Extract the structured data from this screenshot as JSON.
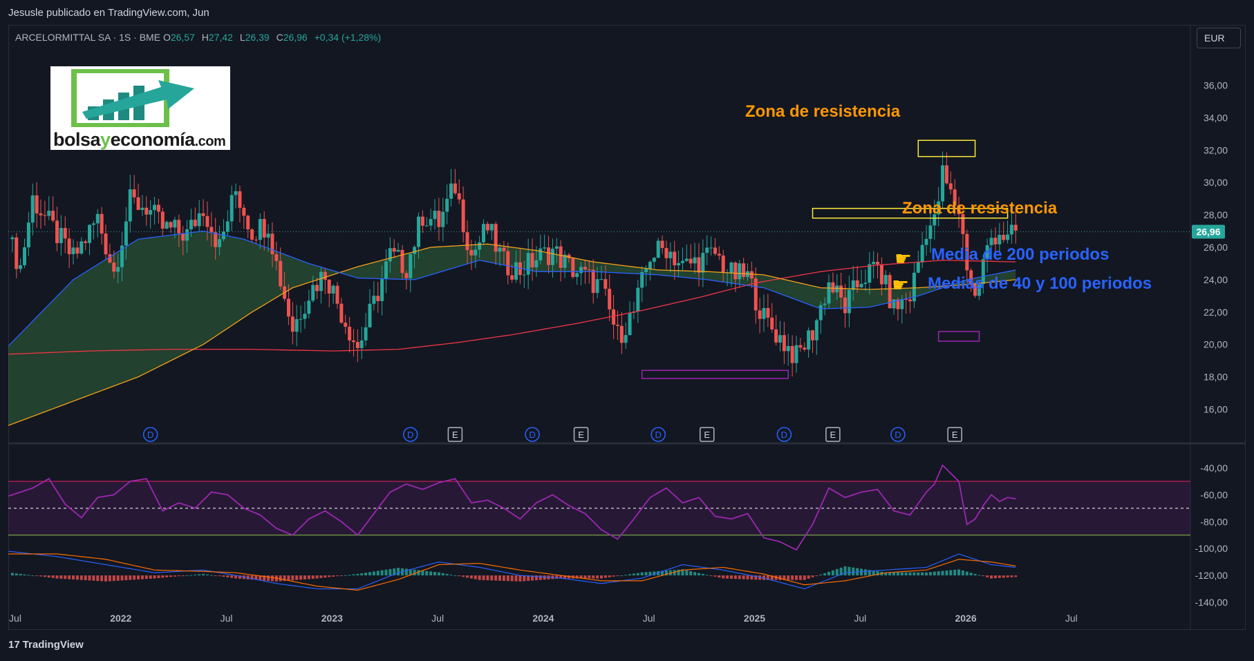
{
  "header": {
    "publisher": "Jesusle publicado en TradingView.com, Jun",
    "symbol": "ARCELORMITTAL SA · 1S · BME",
    "ohlc": [
      {
        "label": "O",
        "value": "26,57"
      },
      {
        "label": "H",
        "value": "27,42"
      },
      {
        "label": "L",
        "value": "26,39"
      },
      {
        "label": "C",
        "value": "26,96"
      }
    ],
    "change": "+0,34 (+1,28%)",
    "currency": "EUR"
  },
  "logo": {
    "part1": "bolsa",
    "part2": "y",
    "part3": "economía",
    "part4": ".com"
  },
  "annotations": {
    "resistance_top": "Zona de resistencia",
    "resistance_mid": "Zona de resistencia",
    "ma200": "Media de 200 periodos",
    "ma40_100": "Medias de 40 y 100 periodos"
  },
  "footer": {
    "brand": "TradingView"
  },
  "colors": {
    "background": "#131722",
    "up": "#26a69a",
    "down": "#ef5350",
    "ma40": "#2962ff",
    "ma100": "#f7a21b",
    "ma200": "#f23645",
    "rsi": "#9c27b0",
    "annotation_orange": "#ff9800",
    "annotation_blue": "#2962ff"
  },
  "chart_data": [
    {
      "type": "candlestick",
      "title": "",
      "ylim": [
        15,
        37
      ],
      "y_ticks": [
        "36,00",
        "34,00",
        "32,00",
        "30,00",
        "28,00",
        "26,00",
        "24,00",
        "22,00",
        "20,00",
        "18,00",
        "16,00"
      ],
      "last_price": "26,96",
      "x_ticks": [
        "Jul",
        "2022",
        "Jul",
        "2023",
        "Jul",
        "2024",
        "Jul",
        "2025",
        "Jul",
        "2026",
        "Jul"
      ],
      "x_range_weeks": [
        0,
        291
      ],
      "event_markers": [
        {
          "label": "D",
          "week": 35,
          "kind": "dividend"
        },
        {
          "label": "D",
          "week": 99,
          "kind": "dividend"
        },
        {
          "label": "E",
          "week": 110,
          "kind": "earnings"
        },
        {
          "label": "D",
          "week": 129,
          "kind": "dividend"
        },
        {
          "label": "E",
          "week": 141,
          "kind": "earnings"
        },
        {
          "label": "D",
          "week": 160,
          "kind": "dividend"
        },
        {
          "label": "E",
          "week": 172,
          "kind": "earnings"
        },
        {
          "label": "D",
          "week": 191,
          "kind": "dividend"
        },
        {
          "label": "E",
          "week": 203,
          "kind": "earnings"
        },
        {
          "label": "D",
          "week": 219,
          "kind": "dividend"
        },
        {
          "label": "E",
          "week": 233,
          "kind": "earnings"
        }
      ],
      "price_anchors": [
        [
          0,
          26.5
        ],
        [
          3,
          24.8
        ],
        [
          6,
          29.0
        ],
        [
          10,
          27.5
        ],
        [
          16,
          25.3
        ],
        [
          22,
          27.8
        ],
        [
          26,
          24.5
        ],
        [
          30,
          28.8
        ],
        [
          34,
          28.5
        ],
        [
          38,
          27.2
        ],
        [
          44,
          26.8
        ],
        [
          48,
          28.5
        ],
        [
          52,
          26.0
        ],
        [
          56,
          29.5
        ],
        [
          60,
          27.0
        ],
        [
          64,
          27.5
        ],
        [
          66,
          25.0
        ],
        [
          70,
          21.0
        ],
        [
          74,
          23.2
        ],
        [
          78,
          24.5
        ],
        [
          82,
          22.0
        ],
        [
          86,
          19.8
        ],
        [
          90,
          22.5
        ],
        [
          94,
          25.5
        ],
        [
          98,
          24.8
        ],
        [
          102,
          28.0
        ],
        [
          106,
          27.5
        ],
        [
          110,
          29.8
        ],
        [
          114,
          25.5
        ],
        [
          118,
          27.2
        ],
        [
          122,
          25.0
        ],
        [
          126,
          24.6
        ],
        [
          130,
          25.3
        ],
        [
          134,
          25.8
        ],
        [
          138,
          24.8
        ],
        [
          142,
          24.2
        ],
        [
          146,
          23.5
        ],
        [
          150,
          20.5
        ],
        [
          154,
          22.0
        ],
        [
          158,
          25.5
        ],
        [
          162,
          26.0
        ],
        [
          166,
          24.8
        ],
        [
          170,
          25.2
        ],
        [
          174,
          25.6
        ],
        [
          178,
          24.3
        ],
        [
          182,
          24.2
        ],
        [
          186,
          21.6
        ],
        [
          190,
          20.4
        ],
        [
          194,
          19.2
        ],
        [
          198,
          20.8
        ],
        [
          202,
          23.8
        ],
        [
          206,
          22.3
        ],
        [
          210,
          24.1
        ],
        [
          214,
          24.8
        ],
        [
          218,
          22.2
        ],
        [
          222,
          23.0
        ],
        [
          226,
          27.2
        ],
        [
          228,
          27.5
        ],
        [
          230,
          30.5
        ],
        [
          232,
          29.2
        ],
        [
          234,
          28.3
        ],
        [
          236,
          25.0
        ],
        [
          238,
          22.8
        ],
        [
          240,
          25.0
        ],
        [
          242,
          26.6
        ],
        [
          244,
          27.0
        ],
        [
          246,
          26.4
        ],
        [
          248,
          26.96
        ]
      ],
      "ma40_anchors": [
        [
          0,
          19.9
        ],
        [
          16,
          24.0
        ],
        [
          32,
          26.5
        ],
        [
          48,
          27.0
        ],
        [
          58,
          26.5
        ],
        [
          74,
          25.0
        ],
        [
          86,
          24.1
        ],
        [
          100,
          24.0
        ],
        [
          116,
          25.2
        ],
        [
          130,
          24.5
        ],
        [
          144,
          24.5
        ],
        [
          160,
          24.3
        ],
        [
          172,
          24.0
        ],
        [
          186,
          23.5
        ],
        [
          200,
          22.2
        ],
        [
          212,
          22.3
        ],
        [
          224,
          23.0
        ],
        [
          236,
          24.0
        ],
        [
          248,
          24.6
        ]
      ],
      "ma100_anchors": [
        [
          0,
          15.0
        ],
        [
          16,
          16.5
        ],
        [
          32,
          18.0
        ],
        [
          48,
          20.0
        ],
        [
          60,
          22.0
        ],
        [
          70,
          23.5
        ],
        [
          86,
          24.8
        ],
        [
          104,
          26.0
        ],
        [
          118,
          26.2
        ],
        [
          130,
          25.8
        ],
        [
          144,
          25.1
        ],
        [
          160,
          24.6
        ],
        [
          172,
          24.5
        ],
        [
          186,
          24.3
        ],
        [
          200,
          23.5
        ],
        [
          212,
          23.4
        ],
        [
          224,
          23.5
        ],
        [
          236,
          23.7
        ],
        [
          248,
          24.0
        ]
      ],
      "ma200_anchors": [
        [
          0,
          19.4
        ],
        [
          20,
          19.6
        ],
        [
          40,
          19.7
        ],
        [
          60,
          19.7
        ],
        [
          80,
          19.6
        ],
        [
          96,
          19.7
        ],
        [
          110,
          20.1
        ],
        [
          124,
          20.6
        ],
        [
          140,
          21.3
        ],
        [
          156,
          22.1
        ],
        [
          170,
          22.9
        ],
        [
          184,
          23.8
        ],
        [
          200,
          24.5
        ],
        [
          214,
          24.9
        ],
        [
          230,
          25.2
        ],
        [
          248,
          25.1
        ]
      ],
      "zones": [
        {
          "label": "resistance_top",
          "from_week": 224,
          "to_week": 238,
          "y_top": 32.6,
          "y_bottom": 31.6,
          "color": "#ffeb3b"
        },
        {
          "label": "resistance_mid",
          "from_week": 198,
          "to_week": 246,
          "y_top": 28.4,
          "y_bottom": 27.8,
          "color": "#ffeb3b"
        },
        {
          "label": "support_low",
          "from_week": 156,
          "to_week": 192,
          "y_top": 18.4,
          "y_bottom": 17.9,
          "color": "#9c27b0"
        },
        {
          "label": "support_mid",
          "from_week": 229,
          "to_week": 239,
          "y_top": 20.8,
          "y_bottom": 20.2,
          "color": "#9c27b0"
        }
      ]
    },
    {
      "type": "line",
      "title": "",
      "ylim": [
        -140,
        -30
      ],
      "y_ticks": [
        "-40,00",
        "-60,00",
        "-80,00",
        "-100,00",
        "-120,00",
        "-140,00"
      ],
      "bands": {
        "upper": -50,
        "middle": -70,
        "lower": -90
      },
      "rsi_anchors": [
        [
          0,
          -61
        ],
        [
          6,
          -55
        ],
        [
          10,
          -48
        ],
        [
          14,
          -67
        ],
        [
          18,
          -77
        ],
        [
          22,
          -62
        ],
        [
          26,
          -60
        ],
        [
          30,
          -50
        ],
        [
          34,
          -48
        ],
        [
          38,
          -72
        ],
        [
          42,
          -66
        ],
        [
          46,
          -70
        ],
        [
          50,
          -58
        ],
        [
          54,
          -60
        ],
        [
          58,
          -70
        ],
        [
          62,
          -75
        ],
        [
          66,
          -85
        ],
        [
          70,
          -90
        ],
        [
          74,
          -78
        ],
        [
          78,
          -72
        ],
        [
          82,
          -80
        ],
        [
          86,
          -90
        ],
        [
          90,
          -74
        ],
        [
          94,
          -58
        ],
        [
          98,
          -52
        ],
        [
          102,
          -56
        ],
        [
          106,
          -51
        ],
        [
          110,
          -48
        ],
        [
          114,
          -66
        ],
        [
          118,
          -64
        ],
        [
          122,
          -70
        ],
        [
          126,
          -78
        ],
        [
          130,
          -66
        ],
        [
          134,
          -60
        ],
        [
          138,
          -68
        ],
        [
          142,
          -74
        ],
        [
          146,
          -86
        ],
        [
          150,
          -93
        ],
        [
          154,
          -78
        ],
        [
          158,
          -62
        ],
        [
          162,
          -55
        ],
        [
          166,
          -66
        ],
        [
          170,
          -62
        ],
        [
          174,
          -76
        ],
        [
          178,
          -78
        ],
        [
          182,
          -74
        ],
        [
          186,
          -92
        ],
        [
          190,
          -95
        ],
        [
          194,
          -101
        ],
        [
          198,
          -82
        ],
        [
          202,
          -55
        ],
        [
          206,
          -62
        ],
        [
          210,
          -58
        ],
        [
          214,
          -56
        ],
        [
          218,
          -72
        ],
        [
          222,
          -75
        ],
        [
          226,
          -58
        ],
        [
          228,
          -52
        ],
        [
          230,
          -38
        ],
        [
          232,
          -44
        ],
        [
          234,
          -50
        ],
        [
          236,
          -82
        ],
        [
          238,
          -78
        ],
        [
          240,
          -68
        ],
        [
          242,
          -60
        ],
        [
          244,
          -65
        ],
        [
          246,
          -62
        ],
        [
          248,
          -63
        ]
      ]
    },
    {
      "type": "bar",
      "title": "",
      "ylim": [
        -140,
        -30
      ],
      "baseline": -120,
      "macd_anchors": [
        [
          0,
          -102
        ],
        [
          12,
          -106
        ],
        [
          24,
          -112
        ],
        [
          36,
          -118
        ],
        [
          48,
          -116
        ],
        [
          56,
          -120
        ],
        [
          66,
          -126
        ],
        [
          76,
          -130
        ],
        [
          86,
          -130
        ],
        [
          96,
          -118
        ],
        [
          106,
          -110
        ],
        [
          116,
          -114
        ],
        [
          126,
          -120
        ],
        [
          136,
          -122
        ],
        [
          146,
          -126
        ],
        [
          156,
          -122
        ],
        [
          166,
          -112
        ],
        [
          176,
          -116
        ],
        [
          186,
          -122
        ],
        [
          196,
          -130
        ],
        [
          206,
          -118
        ],
        [
          216,
          -116
        ],
        [
          226,
          -114
        ],
        [
          234,
          -104
        ],
        [
          242,
          -112
        ],
        [
          248,
          -114
        ]
      ],
      "signal_anchors": [
        [
          0,
          -104
        ],
        [
          12,
          -104
        ],
        [
          24,
          -108
        ],
        [
          36,
          -116
        ],
        [
          48,
          -117
        ],
        [
          56,
          -118
        ],
        [
          66,
          -122
        ],
        [
          76,
          -128
        ],
        [
          86,
          -131
        ],
        [
          96,
          -123
        ],
        [
          106,
          -112
        ],
        [
          116,
          -111
        ],
        [
          126,
          -116
        ],
        [
          136,
          -120
        ],
        [
          146,
          -124
        ],
        [
          156,
          -124
        ],
        [
          166,
          -116
        ],
        [
          176,
          -114
        ],
        [
          186,
          -119
        ],
        [
          196,
          -127
        ],
        [
          206,
          -124
        ],
        [
          216,
          -118
        ],
        [
          226,
          -116
        ],
        [
          234,
          -108
        ],
        [
          242,
          -110
        ],
        [
          248,
          -113
        ]
      ]
    }
  ]
}
